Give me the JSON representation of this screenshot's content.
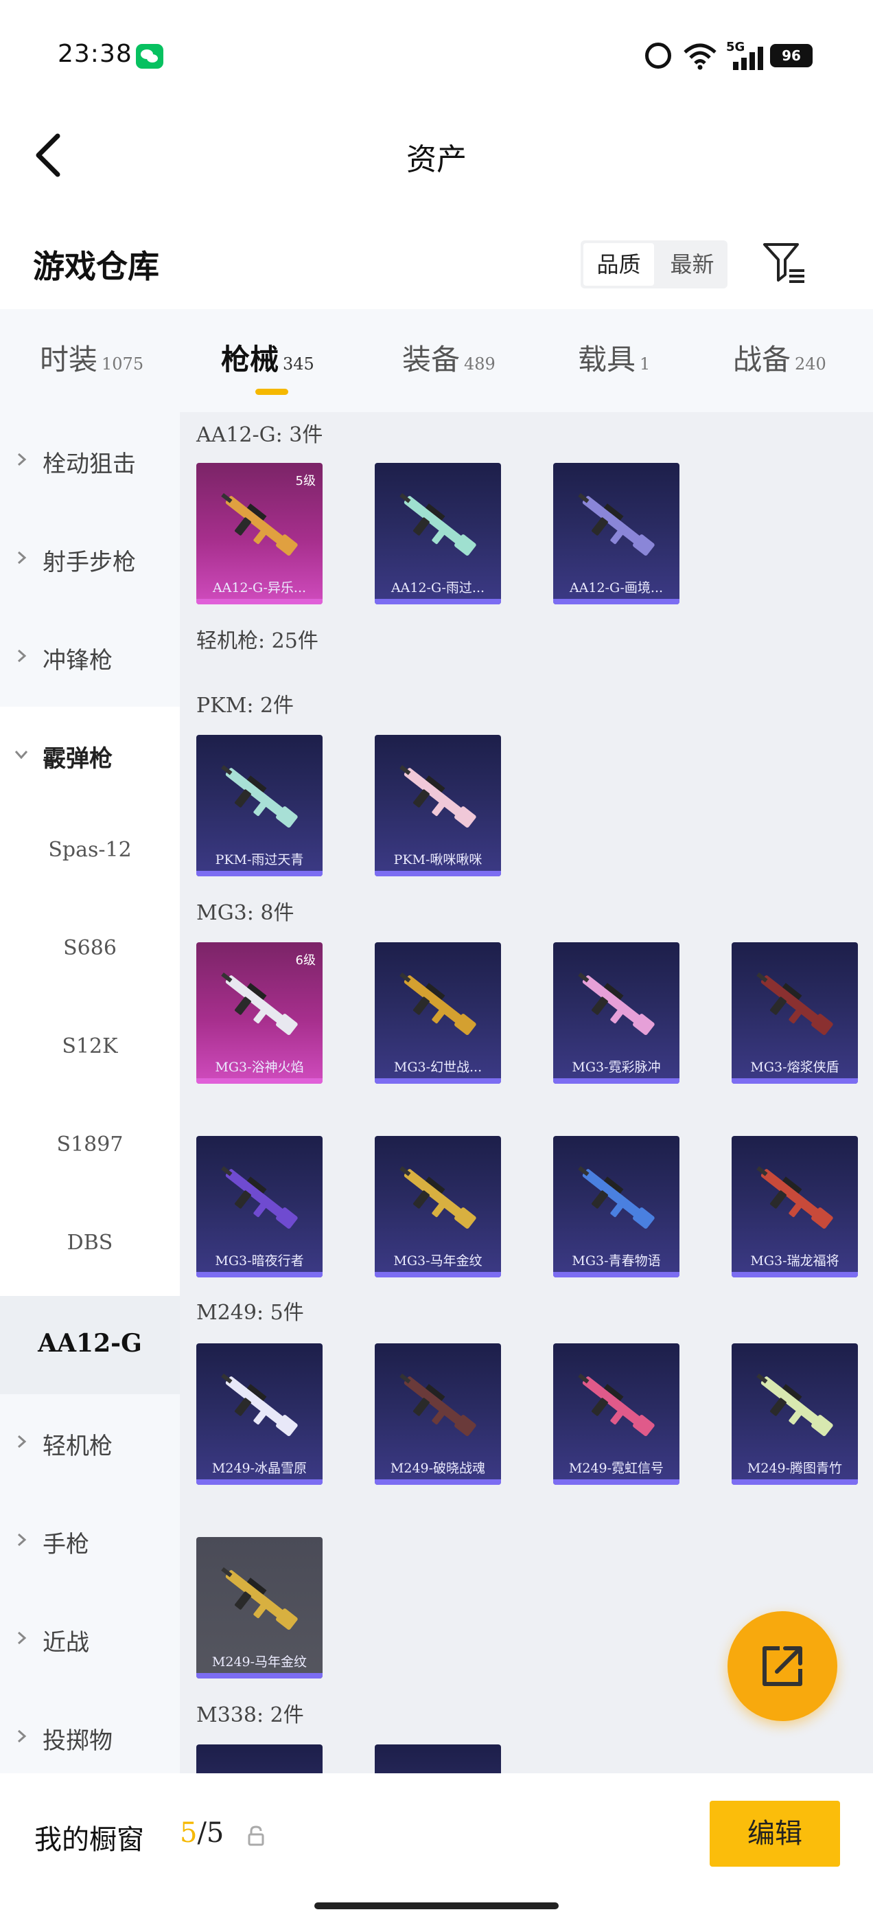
{
  "status_bar": {
    "time": "23:38",
    "network": "5G",
    "battery": "96"
  },
  "header": {
    "title": "资产"
  },
  "warehouse": {
    "title": "游戏仓库",
    "sort_options": [
      "品质",
      "最新"
    ],
    "active_sort": "品质"
  },
  "category_tabs": [
    {
      "label": "时装",
      "count": "1075"
    },
    {
      "label": "枪械",
      "count": "345"
    },
    {
      "label": "装备",
      "count": "489"
    },
    {
      "label": "载具",
      "count": "1"
    },
    {
      "label": "战备",
      "count": "240"
    }
  ],
  "active_tab": "枪械",
  "sidebar": {
    "items": [
      {
        "label": "栓动狙击"
      },
      {
        "label": "射手步枪"
      },
      {
        "label": "冲锋枪"
      },
      {
        "label": "霰弹枪"
      },
      {
        "label": "Spas-12"
      },
      {
        "label": "S686"
      },
      {
        "label": "S12K"
      },
      {
        "label": "S1897"
      },
      {
        "label": "DBS"
      },
      {
        "label": "AA12-G"
      },
      {
        "label": "轻机枪"
      },
      {
        "label": "手枪"
      },
      {
        "label": "近战"
      },
      {
        "label": "投掷物"
      }
    ],
    "selected": "AA12-G"
  },
  "groups": {
    "aa12": {
      "label": "AA12-G: 3件",
      "cards": [
        {
          "name": "AA12-G-异乐...",
          "level": "5级",
          "style": "pink",
          "color": "#e0a040"
        },
        {
          "name": "AA12-G-雨过...",
          "style": "blue",
          "color": "#9fe0d0"
        },
        {
          "name": "AA12-G-画境...",
          "style": "blue",
          "color": "#8a86d8"
        }
      ]
    },
    "lmg_header": {
      "label": "轻机枪: 25件"
    },
    "pkm": {
      "label": "PKM: 2件",
      "cards": [
        {
          "name": "PKM-雨过天青",
          "style": "blue",
          "color": "#a8e0d6"
        },
        {
          "name": "PKM-啾咪啾咪",
          "style": "blue",
          "color": "#f0c8d8"
        }
      ]
    },
    "mg3": {
      "label": "MG3: 8件",
      "cards": [
        {
          "name": "MG3-浴神火焰",
          "level": "6级",
          "style": "pink",
          "color": "#e8e8f0"
        },
        {
          "name": "MG3-幻世战...",
          "style": "blue",
          "color": "#d4a030"
        },
        {
          "name": "MG3-霓彩脉冲",
          "style": "blue",
          "color": "#e6a0d8"
        },
        {
          "name": "MG3-熔浆侠盾",
          "style": "blue",
          "color": "#8a3030"
        },
        {
          "name": "MG3-暗夜行者",
          "style": "blue",
          "color": "#6f4bd0"
        },
        {
          "name": "MG3-马年金纹",
          "style": "blue",
          "color": "#d8b040"
        },
        {
          "name": "MG3-青春物语",
          "style": "blue",
          "color": "#4a80e0"
        },
        {
          "name": "MG3-瑞龙福将",
          "style": "blue",
          "color": "#c84a3a"
        }
      ]
    },
    "m249": {
      "label": "M249: 5件",
      "cards": [
        {
          "name": "M249-冰晶雪原",
          "style": "blue",
          "color": "#e8e8f8"
        },
        {
          "name": "M249-破晓战魂",
          "style": "blue",
          "color": "#6a3a3a"
        },
        {
          "name": "M249-霓虹信号",
          "style": "blue",
          "color": "#e05a8a"
        },
        {
          "name": "M249-腾图青竹",
          "style": "blue",
          "color": "#d8e8b0"
        },
        {
          "name": "M249-马年金纹",
          "style": "gray",
          "color": "#d8b040"
        }
      ]
    },
    "m338": {
      "label": "M338: 2件"
    }
  },
  "bottom_bar": {
    "showcase_label": "我的橱窗",
    "showcase_used": "5",
    "showcase_total": "/5",
    "edit_label": "编辑"
  }
}
